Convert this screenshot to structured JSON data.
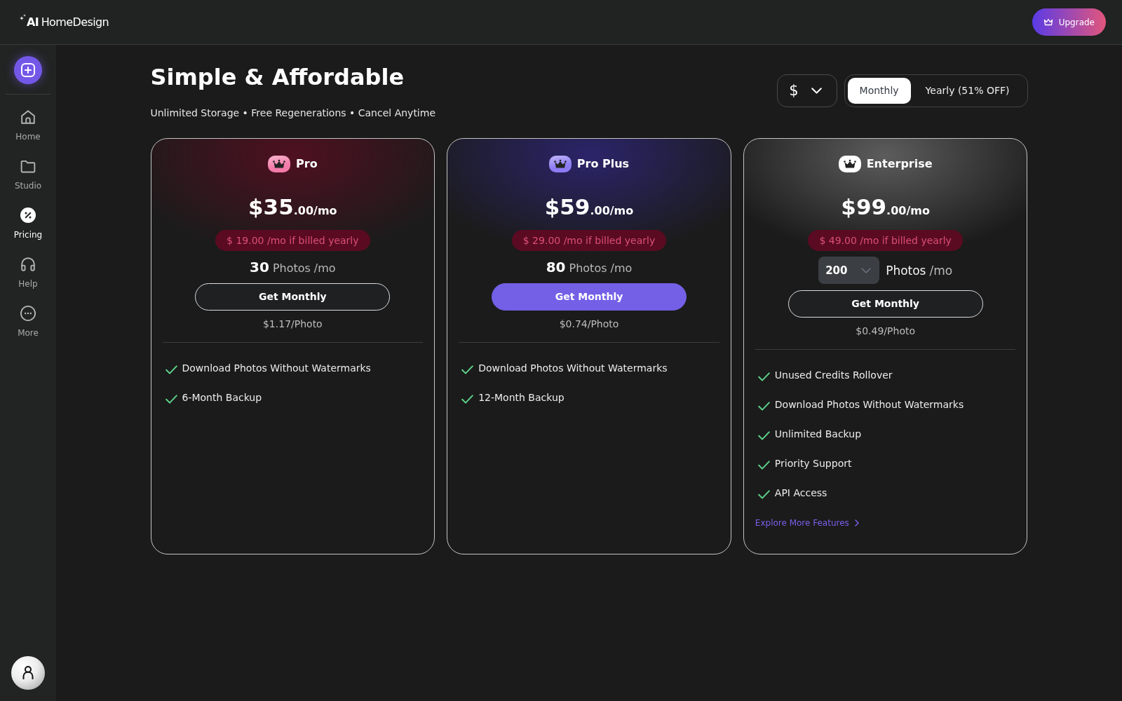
{
  "header": {
    "logo": "**AI** HomeDesign",
    "upgrade_button": "Upgrade"
  },
  "sidebar": {
    "items": [
      {
        "kind": "home",
        "label": "Home",
        "selected": false
      },
      {
        "kind": "folder",
        "label": "Studio",
        "selected": false
      },
      {
        "kind": "pricing",
        "label": "Pricing",
        "selected": true
      },
      {
        "kind": "help",
        "label": "Help",
        "selected": false
      },
      {
        "kind": "more",
        "label": "More",
        "selected": false
      }
    ]
  },
  "page": {
    "title": "Simple & Affordable",
    "subtitle": "Unlimited Storage • Free Regenerations • Cancel Anytime"
  },
  "currency": {
    "symbol": "$"
  },
  "billing": {
    "options": [
      {
        "label": "Monthly",
        "selected": true
      },
      {
        "label": "Yearly (51% OFF)",
        "selected": false
      }
    ]
  },
  "plans": [
    {
      "name": "Pro",
      "color": "#4f1020",
      "badge": {
        "color": "#f27aa8"
      },
      "price": "$35",
      "price_suffix": ".00/mo",
      "yearly_note": "$ 19.00 /mo if billed yearly",
      "photos": {
        "kind": "fixed",
        "count": "30",
        "unit": "Photos",
        "period": "/mo"
      },
      "button": {
        "label": "Get Monthly",
        "primary": false
      },
      "per_photo": "$1.17/Photo",
      "features": [
        "Download Photos Without Watermarks",
        "6-Month Backup"
      ]
    },
    {
      "name": "Pro Plus",
      "color": "#2b246a",
      "badge": {
        "color": "#8c7cf4"
      },
      "price": "$59",
      "price_suffix": ".00/mo",
      "yearly_note": "$ 29.00 /mo if billed yearly",
      "photos": {
        "kind": "fixed",
        "count": "80",
        "unit": "Photos",
        "period": "/mo"
      },
      "button": {
        "label": "Get Monthly",
        "primary": true
      },
      "per_photo": "$0.74/Photo",
      "features": [
        "Download Photos Without Watermarks",
        "12-Month Backup"
      ]
    },
    {
      "name": "Enterprise",
      "color": "#5c5c5c",
      "badge": {
        "color": "#ffffff"
      },
      "price": "$99",
      "price_suffix": ".00/mo",
      "yearly_note": "$ 49.00 /mo if billed yearly",
      "photos": {
        "kind": "select",
        "count": "200",
        "unit": "Photos",
        "period": "/mo"
      },
      "button": {
        "label": "Get Monthly",
        "primary": false
      },
      "per_photo": "$0.49/Photo",
      "features": [
        "Unused Credits Rollover",
        "Download Photos Without Watermarks",
        "Unlimited Backup",
        "Priority Support",
        "API Access"
      ],
      "link": "Explore More Features"
    }
  ]
}
